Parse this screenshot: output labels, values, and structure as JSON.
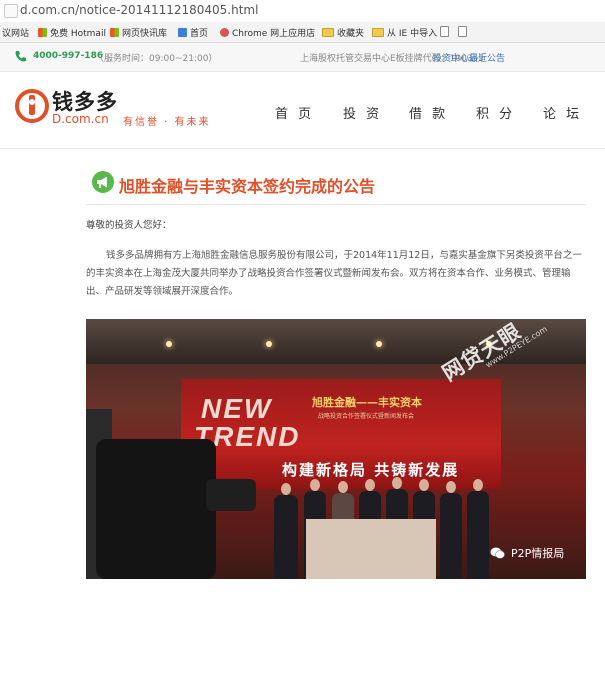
{
  "address_bar": {
    "url": "d.com.cn/notice-20141112180405.html"
  },
  "favorites": [
    {
      "label": "议网站",
      "icon": "doc-icon"
    },
    {
      "label": "免费 Hotmail",
      "icon": "windows-icon"
    },
    {
      "label": "网页快讯库",
      "icon": "windows-icon"
    },
    {
      "label": "首页",
      "icon": "page-icon"
    },
    {
      "label": "Chrome 网上应用店",
      "icon": "chrome-icon"
    },
    {
      "label": "收藏夹",
      "icon": "folder-icon"
    },
    {
      "label": "从 IE 中导入",
      "icon": "folder-icon"
    }
  ],
  "top_info": {
    "phone": "4000-997-186",
    "hours": "（服务时间：09:00~21:00）",
    "exchange": "上海股权托管交易中心E板挂牌代码：100355",
    "notice_link": "投资中心最近公告"
  },
  "header": {
    "logo_cn": "钱多多",
    "logo_en": "D.com.cn",
    "slogan": "有信誉 · 有未来",
    "nav": [
      "首 页",
      "投 资",
      "借 款",
      "积 分",
      "论 坛"
    ]
  },
  "article": {
    "title": "旭胜金融与丰实资本签约完成的公告",
    "greeting": "尊敬的投资人您好：",
    "body": "钱多多品牌拥有方上海旭胜金融信息服务股份有限公司，于2014年11月12日，与嘉实基金旗下另类投资平台之一的丰实资本在上海金茂大厦共同举办了战略投资合作签署仪式暨新闻发布会。双方将在资本合作、业务模式、管理输出、产品研发等领域展开深度合作。"
  },
  "photo": {
    "banner_line1": "NEW",
    "banner_line2": "TREND",
    "banner_title": "旭胜金融——丰实资本",
    "banner_subtitle": "战略投资合作签署仪式暨新闻发布会",
    "banner_slogan": "构建新格局 共铸新发展"
  },
  "watermark": {
    "main": "网贷天眼",
    "sub": "www.P2PEYE.com",
    "wechat": "P2P情报局"
  },
  "colors": {
    "accent": "#e0502a",
    "phone": "#2a9d4f",
    "link": "#3b73b9"
  }
}
